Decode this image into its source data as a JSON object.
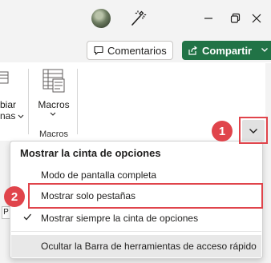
{
  "icons": {
    "user_avatar": "avatar-icon",
    "designer": "magic-wand-icon",
    "minimize": "minimize-icon",
    "restore": "restore-icon",
    "close": "close-icon",
    "comments": "comment-icon",
    "share": "share-icon",
    "macros": "macros-icon",
    "ribbon_options": "chevron-down-icon",
    "check": "checkmark-icon"
  },
  "colors": {
    "share_green": "#217346",
    "callout_red": "#e0444b",
    "titlebar_bg": "#f3f3f3",
    "hover_bg": "#e8e8e8"
  },
  "command_bar": {
    "comments_label": "Comentarios",
    "share_label": "Compartir"
  },
  "ribbon": {
    "partial_group_lines": [
      "biar",
      "nas"
    ],
    "macros_label": "Macros",
    "macros_group_label": "Macros"
  },
  "callouts": {
    "first": "1",
    "second": "2"
  },
  "ribbon_menu": {
    "header": "Mostrar la cinta de opciones",
    "items": [
      {
        "label": "Modo de pantalla completa",
        "checked": false
      },
      {
        "label": "Mostrar solo pestañas",
        "checked": false
      },
      {
        "label": "Mostrar siempre la cinta de opciones",
        "checked": true
      },
      {
        "label": "Ocultar la Barra de herramientas de acceso rápido",
        "checked": false
      }
    ]
  },
  "sheet_fragment": {
    "left_cell": "P"
  }
}
